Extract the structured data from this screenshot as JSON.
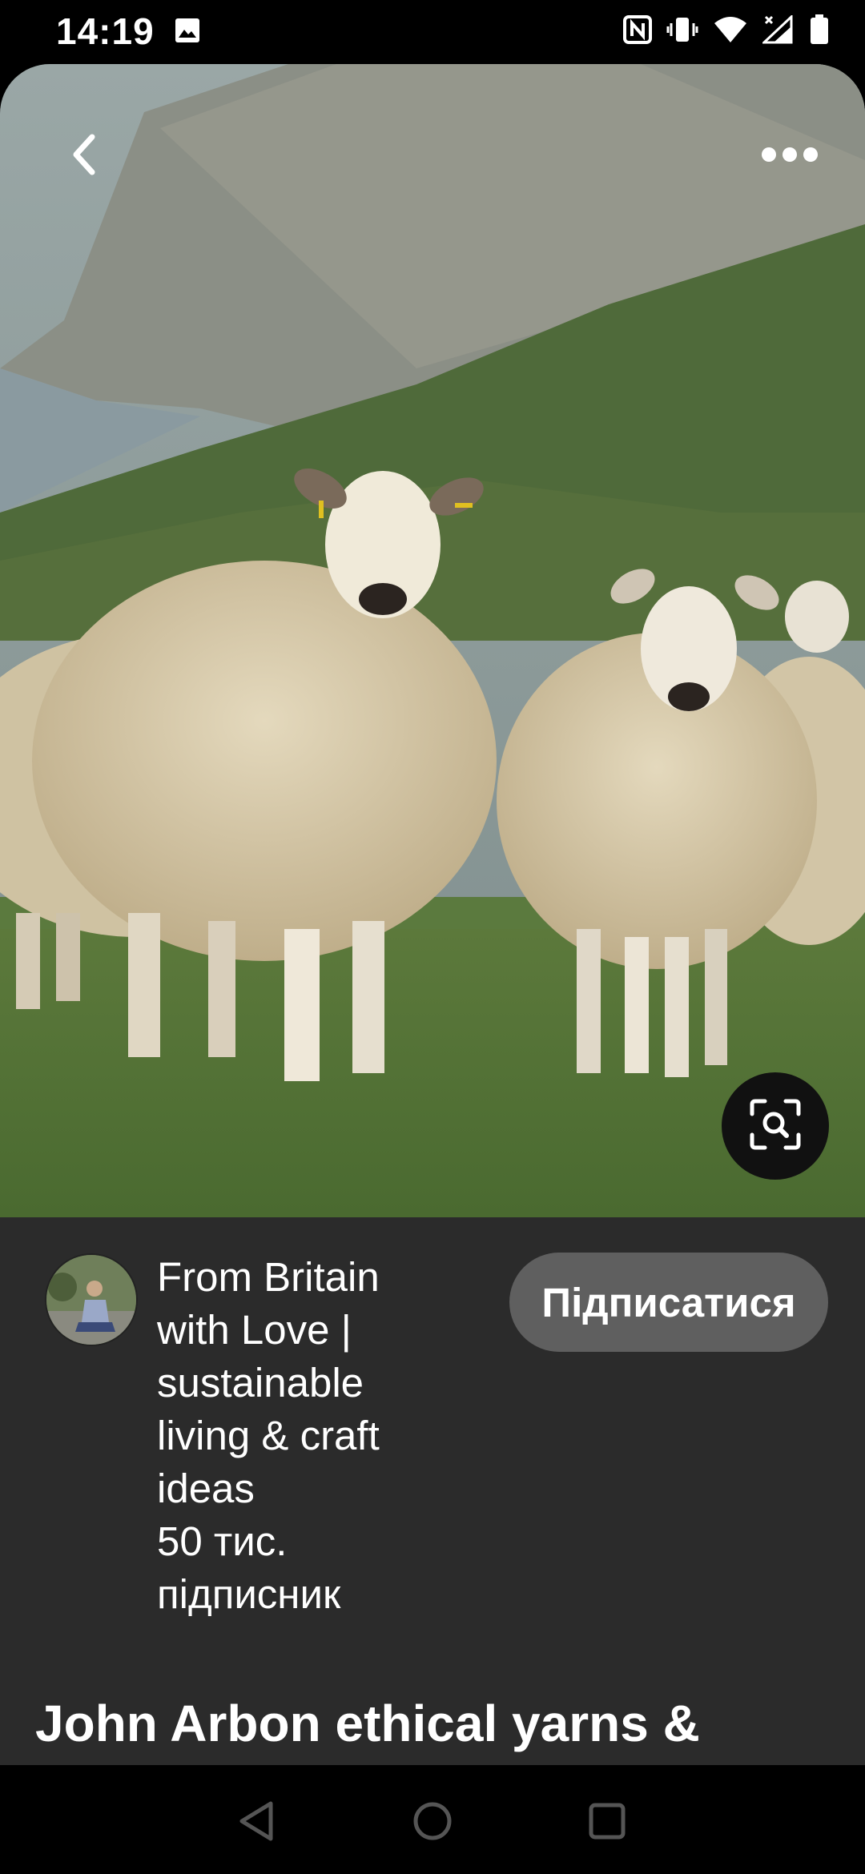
{
  "status_bar": {
    "time": "14:19",
    "icons": [
      "gallery-icon",
      "nfc-icon",
      "vibrate-icon",
      "wifi-icon",
      "signal-icon",
      "battery-icon"
    ]
  },
  "pin": {
    "image_alt": "Sheep on a hillside by the sea",
    "icons": {
      "back": "chevron-left-icon",
      "more": "more-dots-icon",
      "visual_search": "visual-search-icon"
    },
    "title": "John Arbon ethical yarns &"
  },
  "creator": {
    "name": "From Britain with Love | sustainable living & craft ideas",
    "followers": "50 тис. підписник",
    "follow_label": "Підписатися"
  },
  "nav_bar": {
    "icons": [
      "nav-back-icon",
      "nav-home-icon",
      "nav-recents-icon"
    ]
  },
  "colors": {
    "panel": "#2b2b2b",
    "follow_button": "#5f5f5f",
    "text": "#ffffff"
  }
}
